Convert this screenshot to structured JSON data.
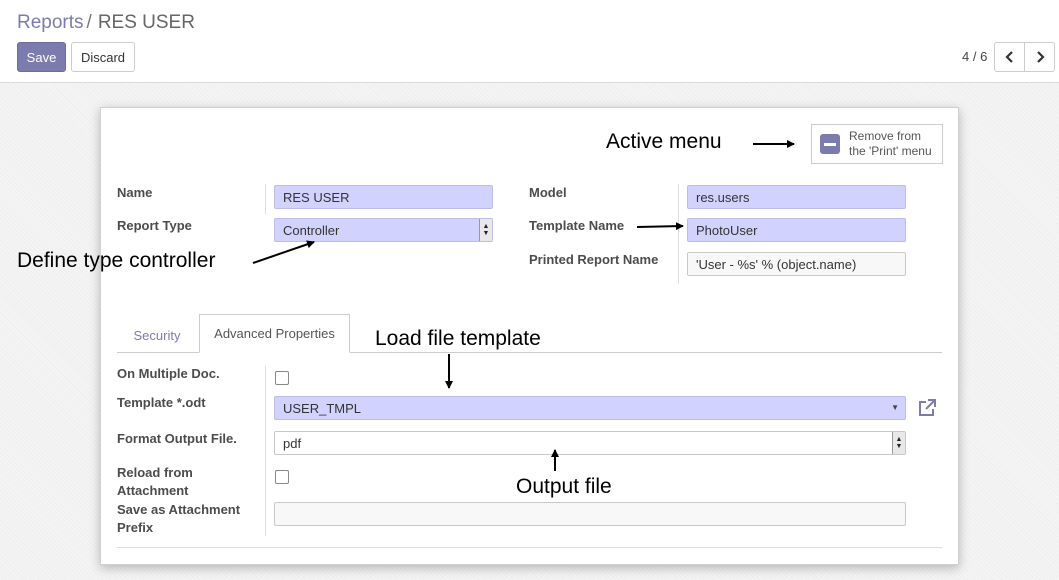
{
  "breadcrumb": {
    "parent": "Reports",
    "separator": "/",
    "current": "RES USER"
  },
  "toolbar": {
    "save_label": "Save",
    "discard_label": "Discard"
  },
  "pager": {
    "value": "4 / 6",
    "prev_icon": "chevron-left-icon",
    "next_icon": "chevron-right-icon"
  },
  "smart_button": {
    "icon": "remove-icon",
    "line1": "Remove from",
    "line2": "the 'Print' menu"
  },
  "fields": {
    "name": {
      "label": "Name",
      "value": "RES USER"
    },
    "report_type": {
      "label": "Report Type",
      "value": "Controller"
    },
    "model": {
      "label": "Model",
      "value": "res.users"
    },
    "template_name": {
      "label": "Template Name",
      "value": "PhotoUser"
    },
    "printed_report_name": {
      "label": "Printed Report Name",
      "value": "'User - %s' % (object.name)"
    }
  },
  "tabs": [
    {
      "label": "Security",
      "active": false
    },
    {
      "label": "Advanced Properties",
      "active": true
    }
  ],
  "advanced": {
    "on_multiple_doc": {
      "label": "On Multiple Doc.",
      "checked": false
    },
    "template_odt": {
      "label": "Template *.odt",
      "value": "USER_TMPL",
      "link_icon": "external-link-icon"
    },
    "format_output": {
      "label": "Format Output File.",
      "value": "pdf"
    },
    "reload_attachment": {
      "label_line1": "Reload from",
      "label_line2": "Attachment",
      "checked": false
    },
    "attachment_prefix": {
      "label_line1": "Save as Attachment",
      "label_line2": "Prefix",
      "value": ""
    }
  },
  "annotations": {
    "active_menu": "Active menu",
    "define_type": "Define type controller",
    "load_template": "Load file template",
    "output_file": "Output file"
  },
  "colors": {
    "accent": "#7c7bad",
    "required_field": "#d2d2ff"
  }
}
